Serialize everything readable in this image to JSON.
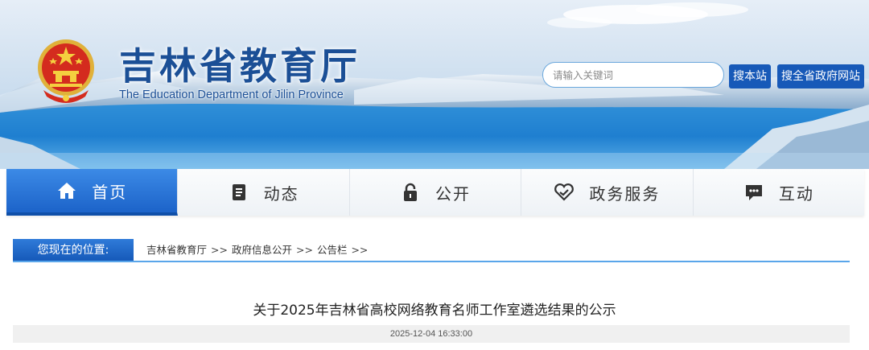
{
  "site": {
    "title_cn": "吉林省教育厅",
    "title_en": "The Education Department of Jilin Province"
  },
  "search": {
    "placeholder": "请输入关键词",
    "site_button": "搜本站",
    "gov_button": "搜全省政府网站"
  },
  "nav": {
    "items": [
      {
        "label": "首页",
        "icon": "home-icon",
        "active": true
      },
      {
        "label": "动态",
        "icon": "document-icon",
        "active": false
      },
      {
        "label": "公开",
        "icon": "lock-icon",
        "active": false
      },
      {
        "label": "政务服务",
        "icon": "handshake-heart-icon",
        "active": false
      },
      {
        "label": "互动",
        "icon": "chat-icon",
        "active": false
      }
    ]
  },
  "breadcrumb": {
    "label": "您现在的位置:",
    "items": [
      "吉林省教育厅",
      "政府信息公开",
      "公告栏"
    ],
    "separator": ">>"
  },
  "article": {
    "title": "关于2025年吉林省高校网络教育名师工作室遴选结果的公示",
    "date": "2025-12-04 16:33:00"
  },
  "colors": {
    "brand_blue": "#1759b8",
    "nav_active": "#2a74d6",
    "title_blue": "#1b4f96"
  }
}
